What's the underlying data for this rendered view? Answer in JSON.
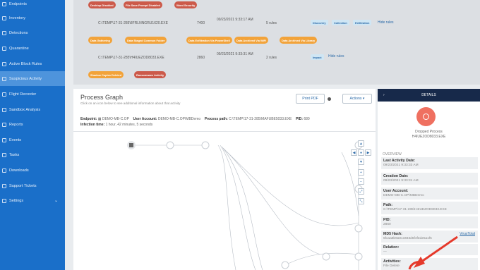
{
  "sidebar": {
    "items": [
      {
        "label": "Endpoints",
        "active": false
      },
      {
        "label": "Inventory",
        "active": false
      },
      {
        "label": "Detections",
        "active": false
      },
      {
        "label": "Quarantine",
        "active": false
      },
      {
        "label": "Active Block Rules",
        "active": false
      },
      {
        "label": "Suspicious Activity",
        "active": true
      },
      {
        "label": "Flight Recorder",
        "active": false
      },
      {
        "label": "Sandbox Analysis",
        "active": false
      },
      {
        "label": "Reports",
        "active": false
      },
      {
        "label": "Events",
        "active": false
      },
      {
        "label": "Tasks",
        "active": false
      },
      {
        "label": "Downloads",
        "active": false
      },
      {
        "label": "Support Tickets",
        "active": false
      },
      {
        "label": "Settings",
        "active": false
      }
    ]
  },
  "top_rows": {
    "tags_row1": [
      "Desktop Disabled",
      "File Save Prompt Disabled",
      "Word Security"
    ],
    "row1": {
      "path": "C:\\TEMP\\17-31-285\\8FRLNNGRU1620.EXE",
      "pid": "7400",
      "time": "09/23/2021 9:33:17 AM",
      "rules": "5 rules",
      "chips": [
        "Discovery",
        "Collection",
        "Exfiltration"
      ],
      "hide": "Hide rules"
    },
    "tags_row2": [
      "Data Gathering",
      "Data Staged Common Folder",
      "Data Exfiltration Via PowerShell",
      "Data Archived Via WiFi",
      "Data Archived Via Library"
    ],
    "row2": {
      "path": "C:\\TEMP\\17-31-285\\H4IUEZOD8033.EXE",
      "pid": "2860",
      "time": "09/23/2021 9:33:31 AM",
      "rules": "2 rules",
      "chips": [
        "Impact"
      ],
      "hide": "Hide rules"
    },
    "tags_row3": [
      "Shadow Copies Deleted",
      "Ransomware Activity"
    ]
  },
  "graph": {
    "title": "Process Graph",
    "subtitle": "Click on an icon below to see additional information about that activity",
    "print_label": "Print PDF",
    "actions_label": "Actions",
    "endpoint_label": "Endpoint:",
    "endpoint_value": "DEMO-MB-C.OP",
    "user_label": "User Account:",
    "user_value": "DEMO-MB-C.OP\\MBDemo",
    "path_label": "Process path:",
    "path_value": "C:\\TEMP\\17-31-285\\MAFUBE5033.EXE",
    "pid_label": "PID:",
    "pid_value": "680",
    "infection_label": "Infection time:",
    "infection_value": "1 hour, 42 minutes, 5 seconds"
  },
  "details": {
    "header": "DETAILS",
    "node_title": "Dropped Process",
    "node_name": "H4IUEZOD8033.EXE",
    "overview": "OVERVIEW",
    "fields": [
      {
        "k": "Last Activity Date:",
        "v": "09/23/2021 9:33:33 AM"
      },
      {
        "k": "Creation Date:",
        "v": "09/23/2021 9:33:31 AM"
      },
      {
        "k": "User Account:",
        "v": "DEMO-MB-C.OP\\MBDemo"
      },
      {
        "k": "Path:",
        "v": "C:\\TEMP\\17-31-285\\H4IUEZOD8033.EXE"
      },
      {
        "k": "PID:",
        "v": "2860"
      },
      {
        "k": "MD5 Hash:",
        "v": "5fcaa8b9a0c3483d6f4f3d25a1f5"
      },
      {
        "k": "Relation:",
        "v": "—"
      },
      {
        "k": "Activities:",
        "v": "File Delete"
      }
    ],
    "virustotal": "VirusTotal"
  },
  "colors": {
    "sidebar": "#1a6fc9",
    "tag_red": "#cc5a4a",
    "tag_orange": "#f2a33a",
    "details_header": "#17294a",
    "accent": "#2b6aa8",
    "annotation": "#e5392b"
  }
}
